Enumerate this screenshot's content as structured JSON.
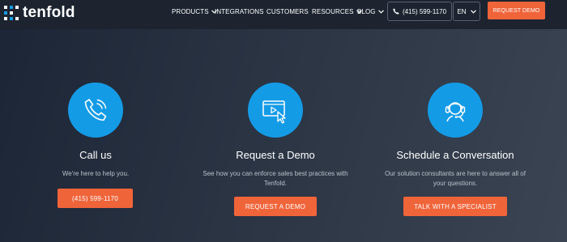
{
  "brand": {
    "name": "tenfold"
  },
  "nav": {
    "products": "PRODUCTS",
    "integrations": "INTEGRATIONS",
    "customers": "CUSTOMERS",
    "resources": "RESOURCES",
    "blog": "BLOG",
    "phone": "(415) 599-1170",
    "language": "EN",
    "request_demo": "REQUEST DEMO"
  },
  "cards": [
    {
      "title": "Call us",
      "description": "We're here to help you.",
      "button": "(415) 599-1170",
      "icon": "phone-icon"
    },
    {
      "title": "Request a Demo",
      "description_line1": "See how you can enforce sales best practices with",
      "description_line2": "Tenfold.",
      "button": "REQUEST A DEMO",
      "icon": "video-cursor-icon"
    },
    {
      "title": "Schedule a Conversation",
      "description_line1": "Our solution consultants are here to answer all of",
      "description_line2": "your questions.",
      "button": "TALK WITH A SPECIALIST",
      "icon": "headset-agent-icon"
    }
  ],
  "colors": {
    "accent": "#f0643a",
    "icon_circle": "#149be6",
    "header_bg": "#1d2430"
  }
}
